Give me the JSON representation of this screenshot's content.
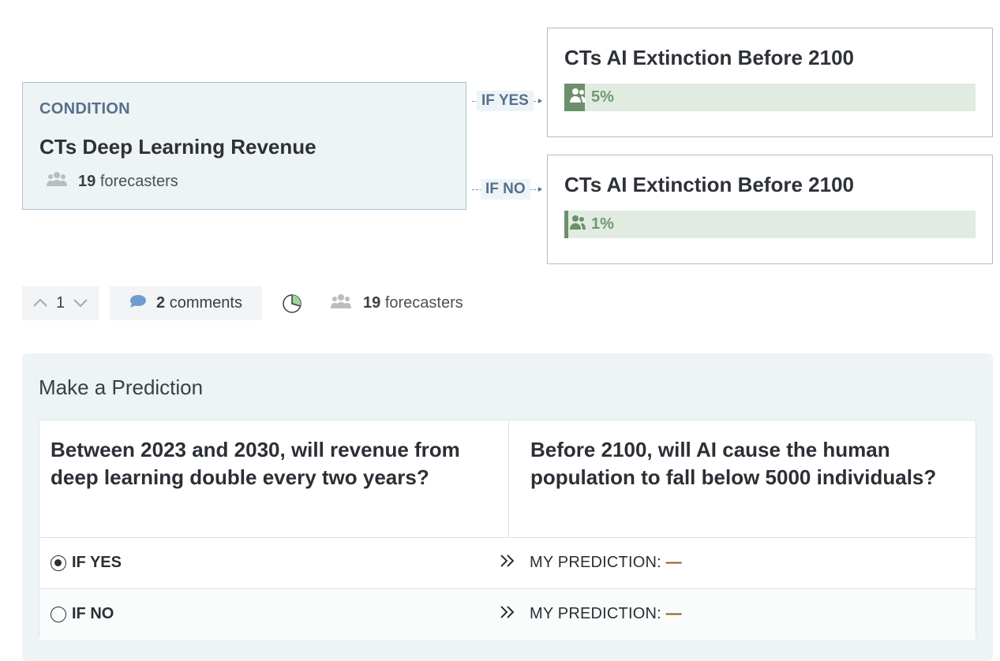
{
  "condition": {
    "label": "CONDITION",
    "title": "CTs Deep Learning Revenue",
    "forecasters_count": "19",
    "forecasters_label": "forecasters"
  },
  "connectors": {
    "yes": "IF YES",
    "no": "IF NO"
  },
  "outcomes": [
    {
      "title": "CTs AI Extinction Before 2100",
      "probability_text": "5%",
      "probability": 0.05
    },
    {
      "title": "CTs AI Extinction Before 2100",
      "probability_text": "1%",
      "probability": 0.01
    }
  ],
  "toolbar": {
    "vote_count": "1",
    "comments_count": "2",
    "comments_label": "comments",
    "forecasters_count": "19",
    "forecasters_label": "forecasters"
  },
  "prediction": {
    "title": "Make a Prediction",
    "question_condition": "Between 2023 and 2030, will revenue from deep learning double every two years?",
    "question_outcome": "Before 2100, will AI cause the human population to fall below 5000 individuals?",
    "rows": [
      {
        "label": "IF YES",
        "my_prediction_label": "MY PREDICTION:",
        "value": "—",
        "selected": true
      },
      {
        "label": "IF NO",
        "my_prediction_label": "MY PREDICTION:",
        "value": "—",
        "selected": false
      }
    ]
  },
  "colors": {
    "accent": "#56708d",
    "bar_fill": "#6c8f6c",
    "bar_bg": "#e1ebe1",
    "panel_bg": "#eef4f5"
  },
  "icons": [
    "people-icon",
    "comment-icon",
    "pie-icon",
    "chevron-up-icon",
    "chevron-down-icon",
    "double-chevron-right-icon"
  ]
}
